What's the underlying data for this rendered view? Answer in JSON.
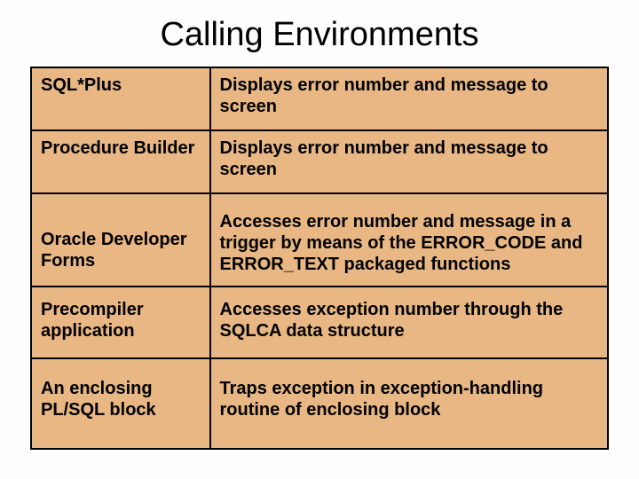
{
  "title": "Calling Environments",
  "rows": [
    {
      "env": "SQL*Plus",
      "desc": "Displays error number and message to screen"
    },
    {
      "env": "Procedure Builder",
      "desc": "Displays error number and message to screen"
    },
    {
      "env": "Oracle Developer Forms",
      "desc": "Accesses error number and message in a trigger by means of the ERROR_CODE and ERROR_TEXT packaged functions"
    },
    {
      "env": "Precompiler application",
      "desc": "Accesses exception number through the SQLCA data structure"
    },
    {
      "env": "An enclosing PL/SQL block",
      "desc": "Traps exception in exception-handling routine of enclosing block"
    }
  ]
}
